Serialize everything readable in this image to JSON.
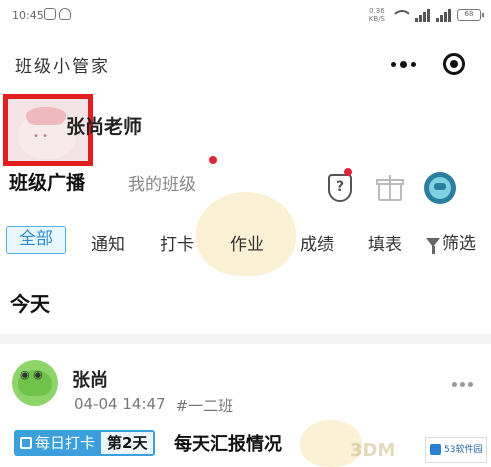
{
  "status_bar": {
    "time": "10:45",
    "net_speed": "0.36\nKB/S",
    "battery": "68"
  },
  "app": {
    "title": "班级小管家"
  },
  "profile": {
    "name": "张尚老师"
  },
  "main_tabs": [
    {
      "label": "班级广播",
      "active": true
    },
    {
      "label": "我的班级",
      "active": false,
      "has_dot": true
    }
  ],
  "header_icons": {
    "shield_symbol": "?"
  },
  "filters": {
    "items": [
      "全部",
      "通知",
      "打卡",
      "作业",
      "成绩",
      "填表"
    ],
    "active": "全部",
    "filter_label": "筛选"
  },
  "section": {
    "today": "今天"
  },
  "post": {
    "author": "张尚",
    "date": "04-04 14:47",
    "class_tag": "#一二班",
    "tag_type": "每日打卡",
    "tag_day": "第2天",
    "title": "每天汇报情况"
  },
  "watermark": {
    "text_3dm": "3DM",
    "logo_text": "53软件园"
  },
  "colors": {
    "accent_blue": "#3a9fdb",
    "highlight_red": "#e21f1f",
    "dot_red": "#e0243a"
  }
}
